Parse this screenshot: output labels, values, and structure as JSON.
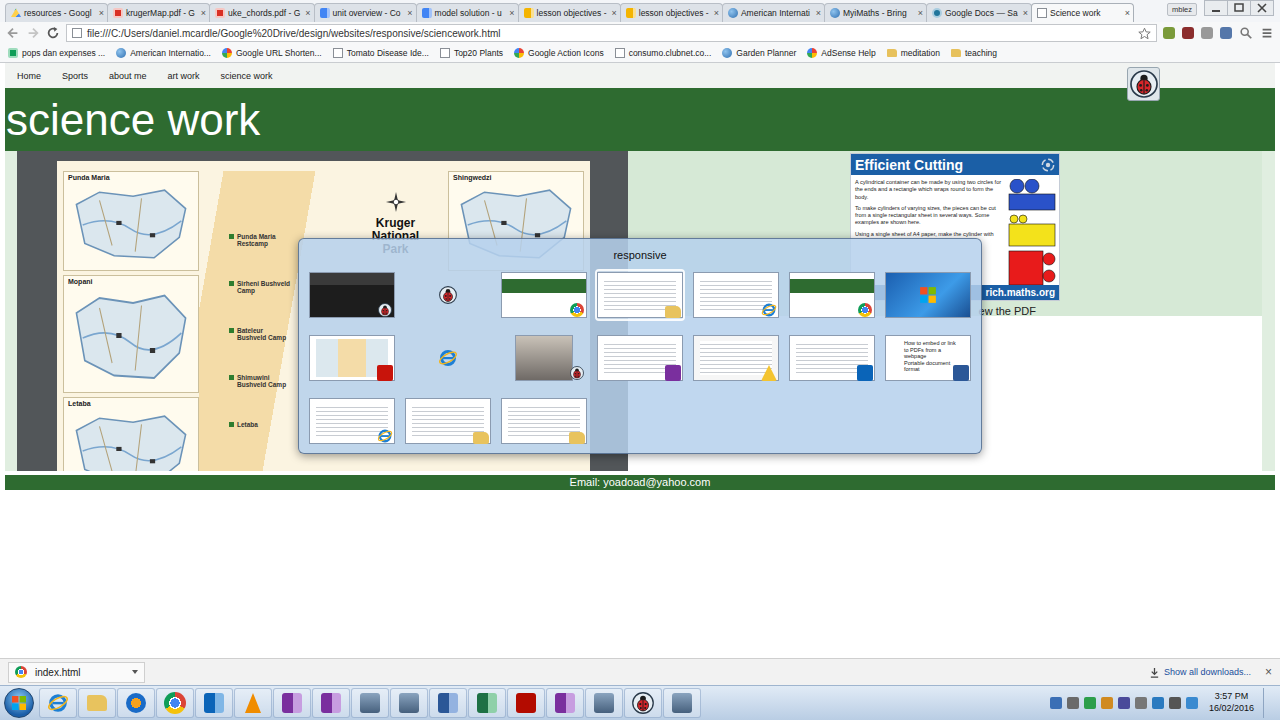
{
  "browser": {
    "tabs": [
      {
        "label": "resources - Googl",
        "kind": "drive",
        "selected": false
      },
      {
        "label": "krugerMap.pdf - G",
        "kind": "pdf",
        "selected": false
      },
      {
        "label": "uke_chords.pdf - G",
        "kind": "pdf",
        "selected": false
      },
      {
        "label": "unit overview - Co",
        "kind": "docs",
        "selected": false
      },
      {
        "label": "model solution - u",
        "kind": "docs",
        "selected": false
      },
      {
        "label": "lesson objectives -",
        "kind": "slides",
        "selected": false
      },
      {
        "label": "lesson objectives -",
        "kind": "slides",
        "selected": false
      },
      {
        "label": "American Internati",
        "kind": "globe",
        "selected": false
      },
      {
        "label": "MyiMaths - Bring",
        "kind": "globe",
        "selected": false
      },
      {
        "label": "Google Docs — Sa",
        "kind": "wordpress",
        "selected": false
      },
      {
        "label": "Science work",
        "kind": "page",
        "selected": true
      }
    ],
    "tab_close": "×",
    "profile": "mblez",
    "url": "file:///C:/Users/daniel.mcardle/Google%20Drive/design/websites/responsive/sciencework.html",
    "bookmarks": [
      {
        "label": "pops dan expenses ...",
        "kind": "sheet"
      },
      {
        "label": "American Internatio...",
        "kind": "globe"
      },
      {
        "label": "Google URL Shorten...",
        "kind": "google"
      },
      {
        "label": "Tomato Disease Ide...",
        "kind": "page"
      },
      {
        "label": "Top20 Plants",
        "kind": "page"
      },
      {
        "label": "Google Action Icons",
        "kind": "google"
      },
      {
        "label": "consumo.clubnet.co...",
        "kind": "page"
      },
      {
        "label": "Garden Planner",
        "kind": "globe"
      },
      {
        "label": "AdSense Help",
        "kind": "google"
      },
      {
        "label": "meditation",
        "kind": "folder"
      },
      {
        "label": "teaching",
        "kind": "folder"
      }
    ]
  },
  "page": {
    "nav": [
      {
        "label": "Home"
      },
      {
        "label": "Sports"
      },
      {
        "label": "about me"
      },
      {
        "label": "art work"
      },
      {
        "label": "science work"
      }
    ],
    "title": "science work",
    "map": {
      "title": "Kruger National Park",
      "left_insets": [
        "Punda Maria",
        "Mopani",
        "Letaba"
      ],
      "right_insets": [
        "Shingwedzi"
      ],
      "camps": [
        "Punda Maria Restcamp",
        "Sirheni Bushveld Camp",
        "Bateleur Bushveld Camp",
        "Shimuwini Bushveld Camp",
        "Letaba"
      ]
    },
    "puzzle": {
      "title": "Efficient Cutting",
      "paragraphs": [
        "A cylindrical container can be made by using two circles for the ends and a rectangle which wraps round to form the body.",
        "To make cylinders of varying sizes, the pieces can be cut from a single rectangular sheet in several ways. Some examples are shown here.",
        "Using a single sheet of A4 paper, make the cylinder with"
      ],
      "site": "rich.maths.org"
    },
    "pdf_link": "ew the PDF",
    "footer": "Email: yoadoad@yahoo.com"
  },
  "switcher": {
    "title": "responsive",
    "windows": [
      {
        "kind": "media",
        "selected": false
      },
      {
        "kind": "icon-ladybug",
        "selected": false
      },
      {
        "kind": "chrome",
        "selected": false
      },
      {
        "kind": "folder",
        "selected": true
      },
      {
        "kind": "ie",
        "selected": false
      },
      {
        "kind": "chrome",
        "selected": false
      },
      {
        "kind": "desktop",
        "selected": false
      },
      {
        "kind": "pdf",
        "selected": false
      },
      {
        "kind": "icon-ie",
        "selected": false
      },
      {
        "kind": "photo",
        "selected": false
      },
      {
        "kind": "onenote",
        "selected": false
      },
      {
        "kind": "drive",
        "selected": false
      },
      {
        "kind": "outlook",
        "selected": false
      },
      {
        "kind": "word",
        "selected": false,
        "lines": [
          "How to embed or link",
          "to PDFs from a",
          "webpage",
          "Portable document",
          "format"
        ]
      },
      {
        "kind": "ie",
        "selected": false
      },
      {
        "kind": "folder",
        "selected": false
      },
      {
        "kind": "folder",
        "selected": false
      }
    ]
  },
  "downloads": {
    "item": "index.html",
    "show_all": "Show all downloads...",
    "close": "×"
  },
  "taskbar": {
    "time": "3:57 PM",
    "date": "16/02/2016"
  }
}
